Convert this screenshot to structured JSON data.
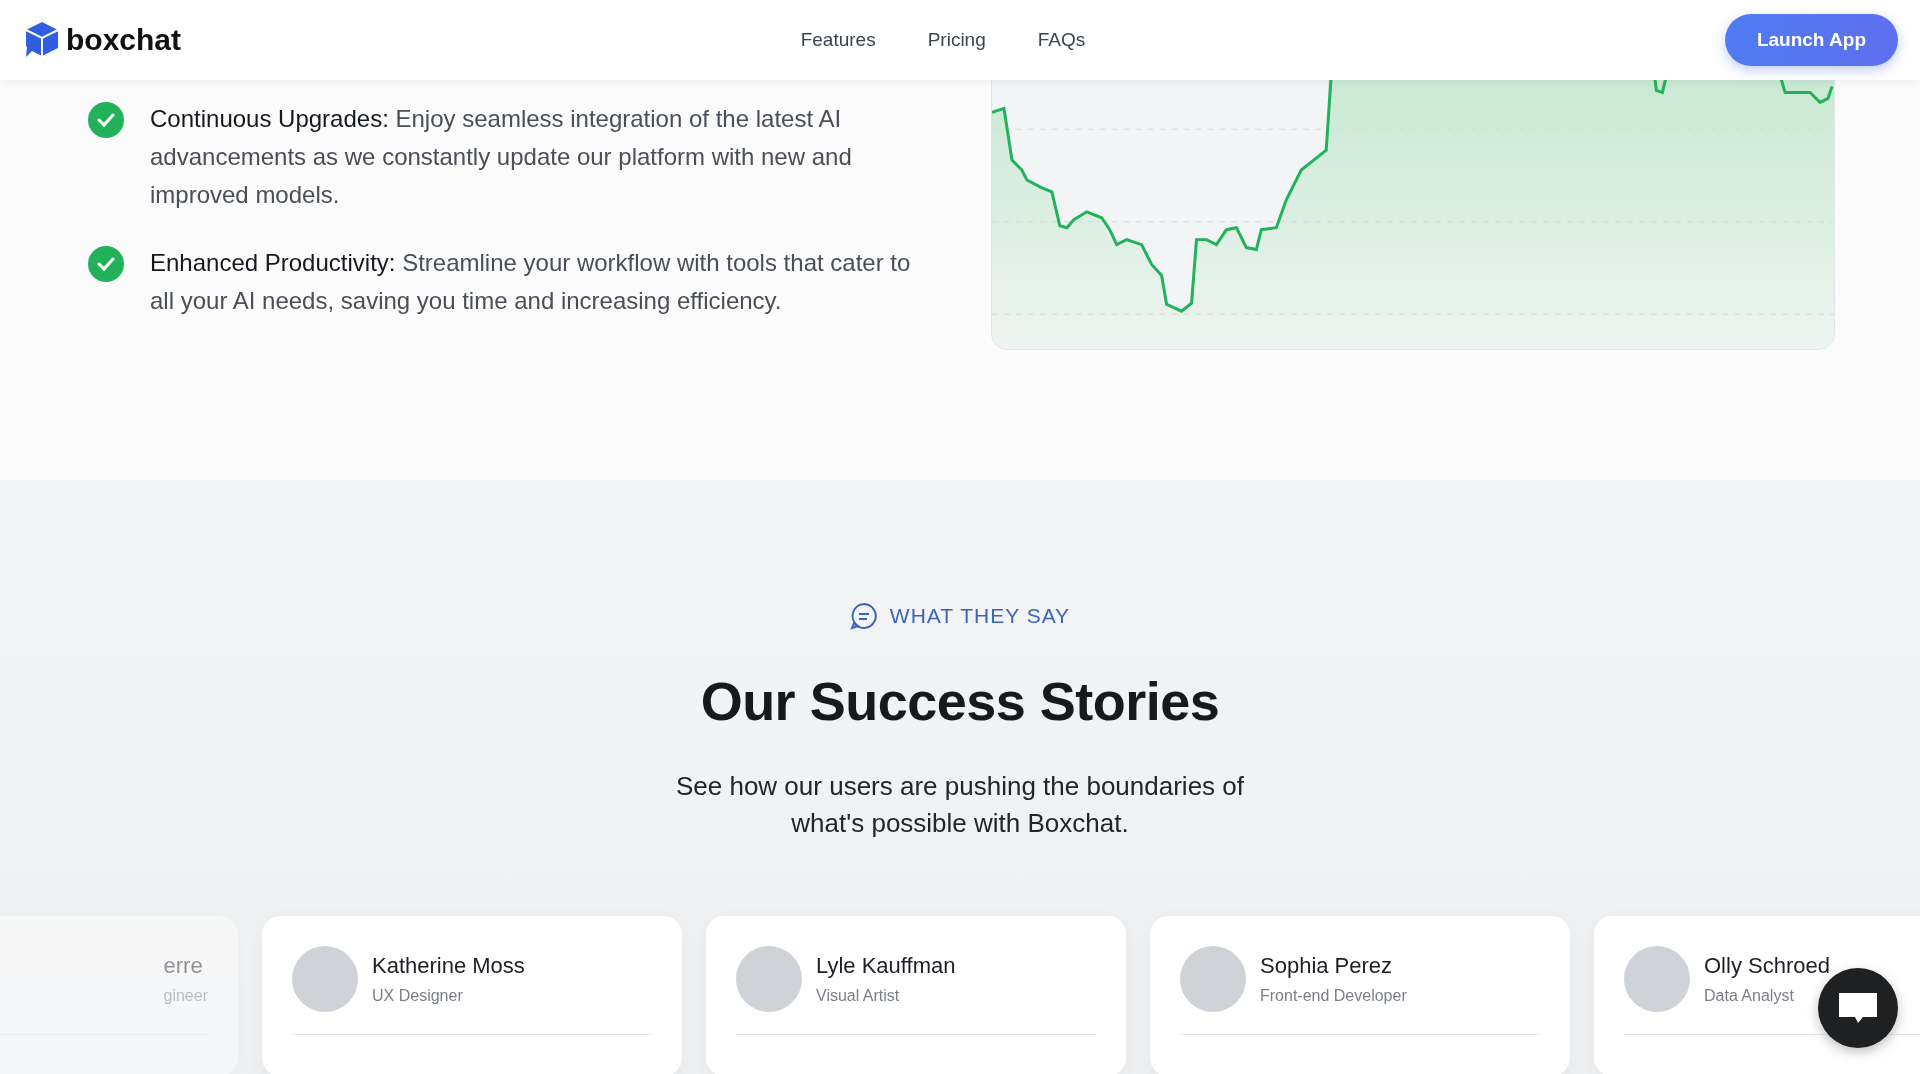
{
  "nav": {
    "logo": "boxchat",
    "links": [
      "Features",
      "Pricing",
      "FAQs"
    ],
    "cta": "Launch App"
  },
  "features": [
    {
      "text": "**Continuous Upgrades:** Enjoy seamless integration of the latest AI advancements as we constantly update our platform with new and improved models."
    },
    {
      "text": "**Enhanced Productivity:** Streamline your workflow with tools that cater to all your AI needs, saving you time and increasing efficiency."
    }
  ],
  "testimonials": {
    "eyebrow": "WHAT THEY SAY",
    "heading": "Our Success Stories",
    "subtitle": "See how our users are pushing the boundaries of what's possible with Boxchat.",
    "people": [
      {
        "name": "erre",
        "role": "gineer",
        "faded": true
      },
      {
        "name": "Katherine Moss",
        "role": "UX Designer",
        "faded": false
      },
      {
        "name": "Lyle Kauffman",
        "role": "Visual Artist",
        "faded": false
      },
      {
        "name": "Sophia Perez",
        "role": "Front-end Developer",
        "faded": false
      },
      {
        "name": "Olly Schroed",
        "role": "Data Analyst",
        "faded": false
      }
    ]
  }
}
